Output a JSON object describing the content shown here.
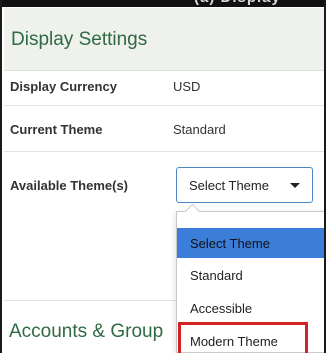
{
  "display_settings": {
    "title": "Display Settings",
    "rows": [
      {
        "label": "Display Currency",
        "value": "USD"
      },
      {
        "label": "Current Theme",
        "value": "Standard"
      },
      {
        "label": "Available Theme(s)"
      }
    ]
  },
  "theme_select": {
    "button_label": "Select Theme",
    "options": [
      "Select Theme",
      "Standard",
      "Accessible",
      "Modern Theme"
    ],
    "selected_index": 0,
    "highlighted_option": "Modern Theme"
  },
  "accounts_section": {
    "title": "Accounts & Group"
  },
  "colors": {
    "accent_green": "#2f6a43",
    "header_bg": "#eef1ec",
    "select_border": "#4a88c8",
    "selected_option": "#3b7dd8",
    "highlight_red": "#d32222"
  }
}
